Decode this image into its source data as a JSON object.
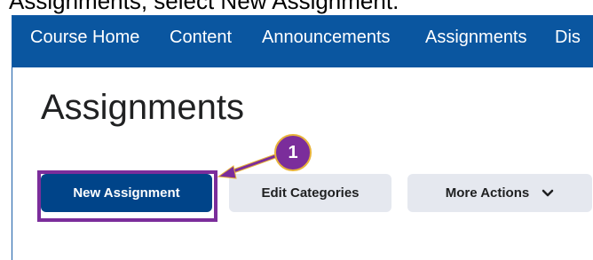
{
  "caption": {
    "text": "Assignments, select New Assignment."
  },
  "nav": {
    "items": [
      {
        "label": "Course Home"
      },
      {
        "label": "Content"
      },
      {
        "label": "Announcements"
      },
      {
        "label": "Assignments"
      },
      {
        "label": "Dis"
      }
    ]
  },
  "page": {
    "title": "Assignments"
  },
  "actions": {
    "new_assignment": "New Assignment",
    "edit_categories": "Edit Categories",
    "more_actions": "More Actions"
  },
  "annotation": {
    "step": "1"
  },
  "icons": {
    "more_actions_chevron": "chevron-down-icon"
  },
  "colors": {
    "navbar": "#0a56a0",
    "primary_button": "#004489",
    "secondary_button": "#e5e8ef",
    "annotation": "#7b2d9b",
    "annotation_ring": "#e8b33a"
  }
}
